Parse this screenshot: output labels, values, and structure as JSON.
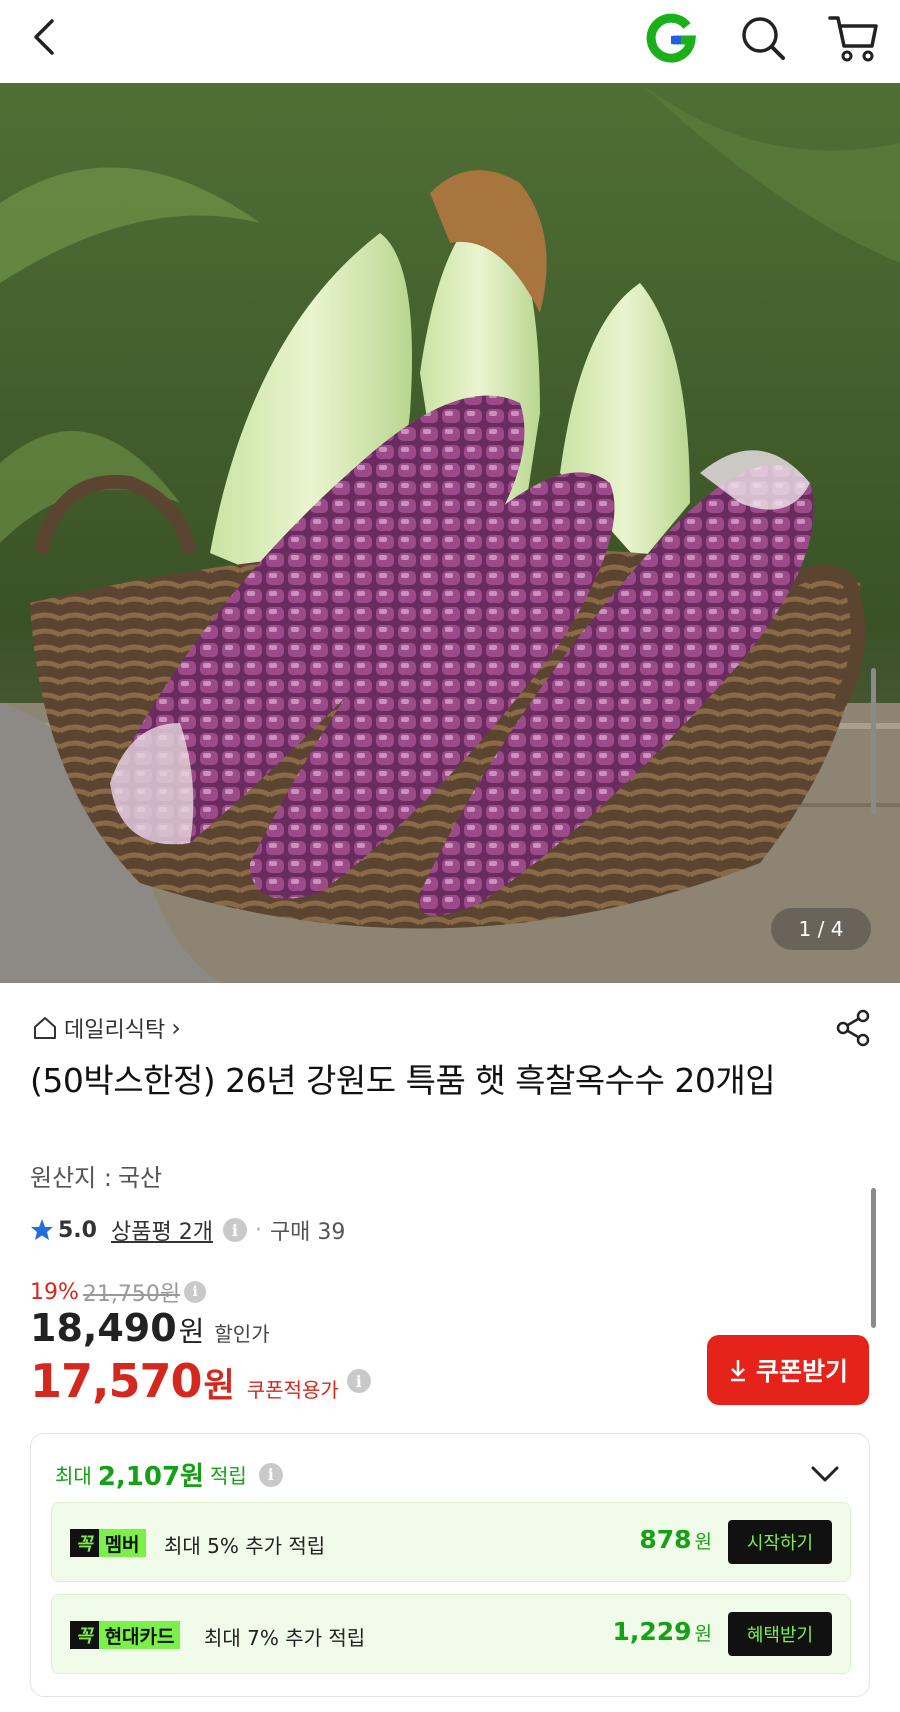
{
  "header": {
    "back_icon": "chevron-left-icon",
    "logo_icon": "g-logo-icon",
    "search_icon": "search-icon",
    "cart_icon": "cart-icon",
    "brand_color": "#19b019"
  },
  "gallery": {
    "page_indicator": "1 / 4"
  },
  "product": {
    "store_name": "데일리식탁",
    "store_arrow": "›",
    "title": "(50박스한정) 26년 강원도 특품 햇 흑찰옥수수 20개입",
    "origin_label": "원산지 :",
    "origin_value": "국산",
    "rating": "5.0",
    "review_label": "상품평 2개",
    "dot": "·",
    "sold_label": "구매 39"
  },
  "price": {
    "discount_pct": "19%",
    "original_price": "21,750원",
    "sale_price": "18,490",
    "sale_unit": "원",
    "sale_label": "할인가",
    "coupon_price": "17,570",
    "coupon_unit": "원",
    "coupon_label": "쿠폰적용가",
    "coupon_button": "쿠폰받기",
    "accent_color": "#e5231b"
  },
  "rewards": {
    "head_prefix": "최대",
    "head_amount": "2,107원",
    "head_suffix": "적립",
    "items": [
      {
        "badge_k": "꼭",
        "badge_t": "멤버",
        "desc": "최대 5% 추가 적립",
        "points": "878",
        "unit": "원",
        "action": "시작하기"
      },
      {
        "badge_k": "꼭",
        "badge_t": "현대카드",
        "desc": "최대 7% 추가 적립",
        "points": "1,229",
        "unit": "원",
        "action": "혜택받기"
      }
    ],
    "accent_color": "#13a213"
  },
  "info_glyph": "i"
}
